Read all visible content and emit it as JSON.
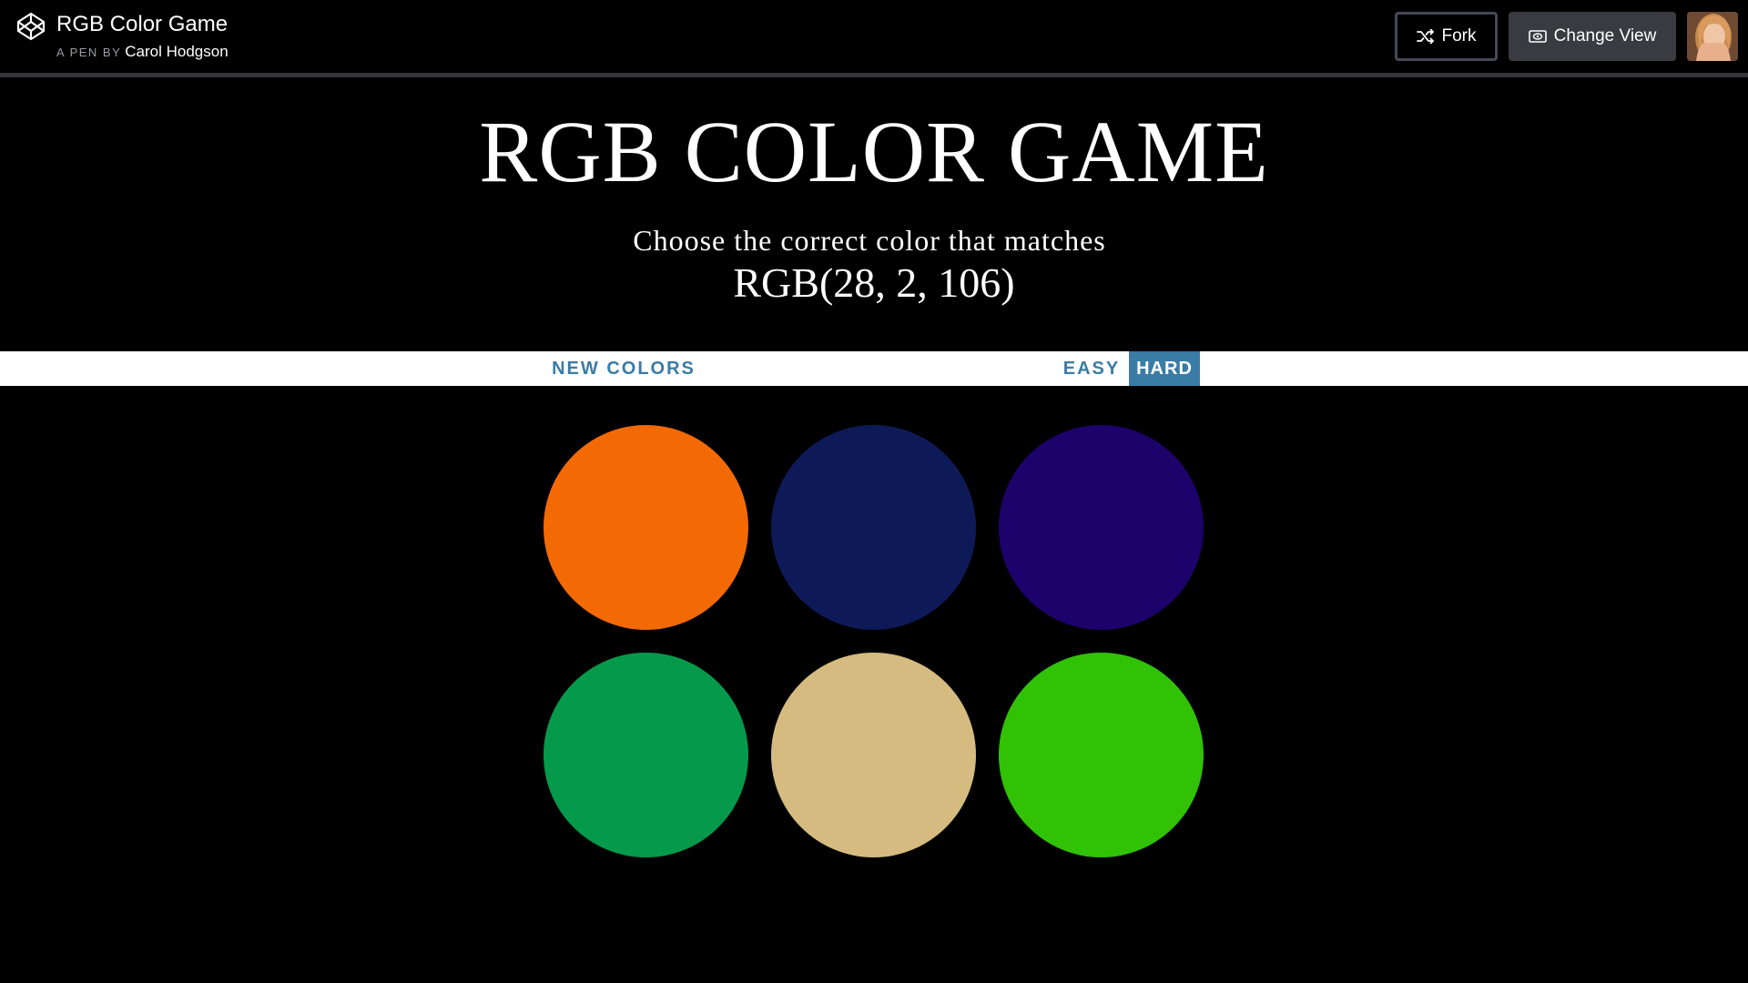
{
  "codepen": {
    "pen_title": "RGB Color Game",
    "by_prefix": "A PEN BY",
    "author": "Carol Hodgson",
    "fork_label": "Fork",
    "change_view_label": "Change View"
  },
  "game": {
    "title": "RGB COLOR GAME",
    "instruction": "Choose the correct color that matches",
    "target_rgb": "RGB(28, 2, 106)",
    "new_colors_label": "NEW COLORS",
    "easy_label": "EASY",
    "hard_label": "HARD",
    "active_mode": "HARD",
    "squares": [
      {
        "color": "#f36a05"
      },
      {
        "color": "#0e1a57"
      },
      {
        "color": "#1c026a"
      },
      {
        "color": "#059a4b"
      },
      {
        "color": "#d5bb7f"
      },
      {
        "color": "#31c206"
      }
    ]
  },
  "colors": {
    "accent": "#3a7ca5",
    "background": "#000000",
    "stripe": "#ffffff"
  }
}
